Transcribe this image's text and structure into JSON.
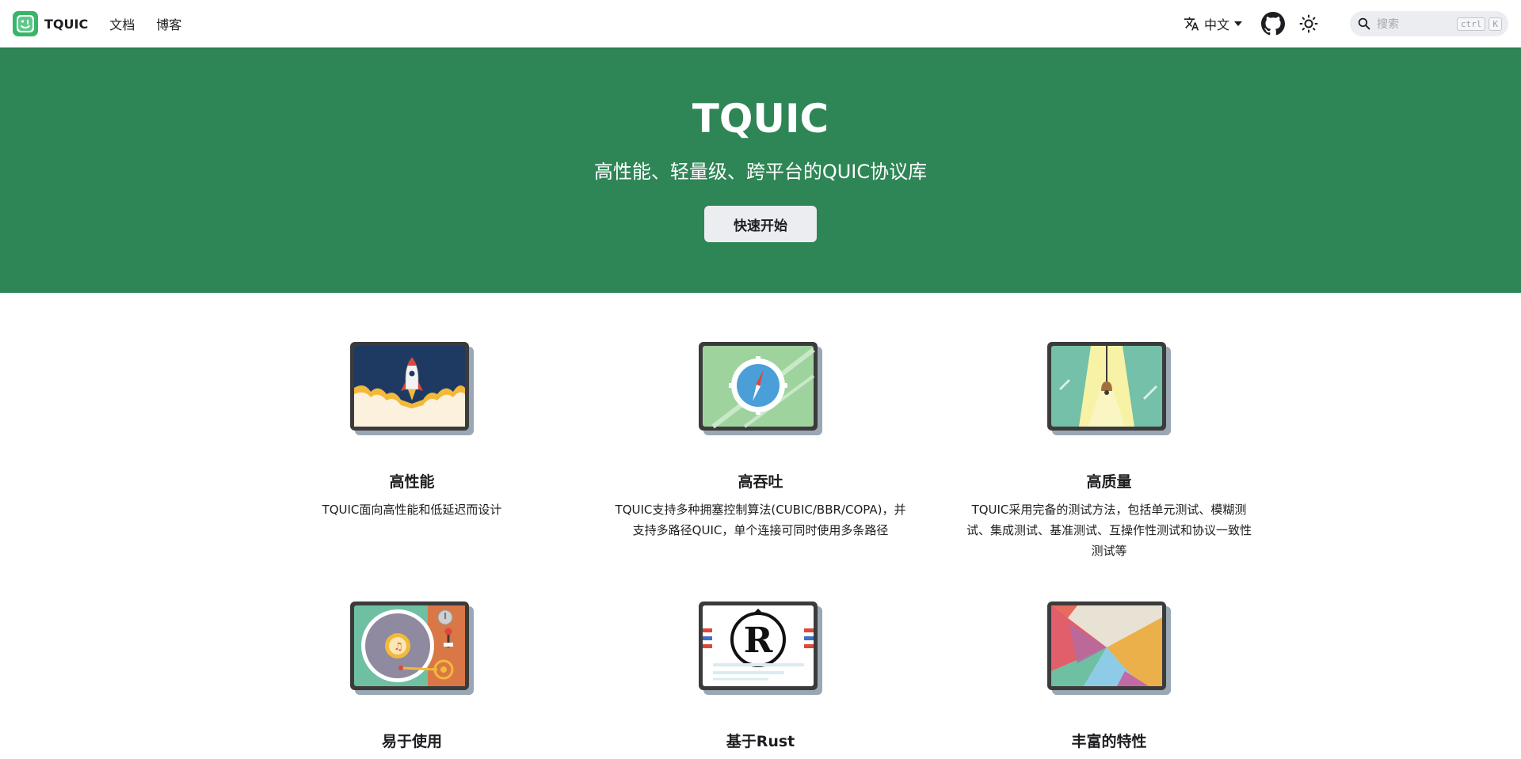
{
  "navbar": {
    "brand": "TQUIC",
    "links": [
      "文档",
      "博客"
    ],
    "language": "中文",
    "search_placeholder": "搜索",
    "search_keys": [
      "ctrl",
      "K"
    ]
  },
  "hero": {
    "title": "TQUIC",
    "subtitle": "高性能、轻量级、跨平台的QUIC协议库",
    "button": "快速开始",
    "background": "#2e8555"
  },
  "features": [
    {
      "title": "高性能",
      "description": "TQUIC面向高性能和低延迟而设计",
      "icon": "rocket-launch-icon"
    },
    {
      "title": "高吞吐",
      "description": "TQUIC支持多种拥塞控制算法(CUBIC/BBR/COPA)，并支持多路径QUIC，单个连接可同时使用多条路径",
      "icon": "compass-icon"
    },
    {
      "title": "高质量",
      "description": "TQUIC采用完备的测试方法，包括单元测试、模糊测试、集成测试、基准测试、互操作性测试和协议一致性测试等",
      "icon": "spotlight-lamp-icon"
    },
    {
      "title": "易于使用",
      "description": "",
      "icon": "turntable-icon"
    },
    {
      "title": "基于Rust",
      "description": "",
      "icon": "rust-logo-icon"
    },
    {
      "title": "丰富的特性",
      "description": "",
      "icon": "geometric-pattern-icon"
    }
  ]
}
